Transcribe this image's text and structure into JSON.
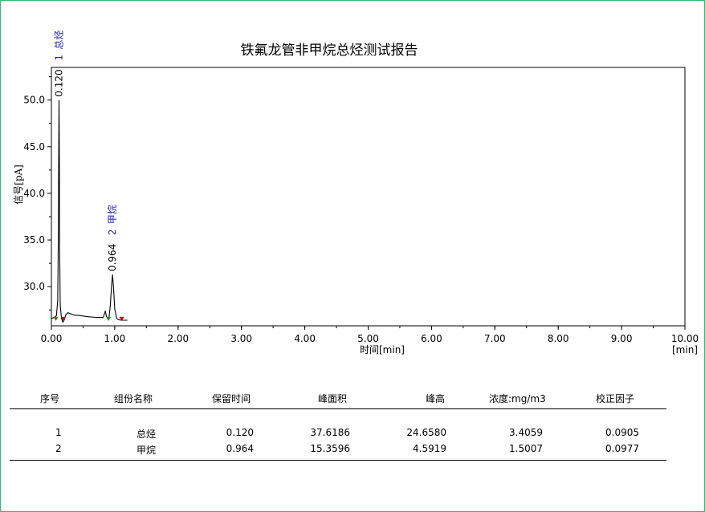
{
  "colors": {
    "border": "#3cb371",
    "trace": "#000000",
    "label_blue": "#1f1fbf",
    "marker_green": "#1a8f1a",
    "marker_red": "#cc0000"
  },
  "chart_data": {
    "type": "line",
    "title": "铁氟龙管非甲烷总烃测试报告",
    "xlabel": "时间[min]",
    "xunit": "[min]",
    "ylabel": "信号[pA]",
    "xlim": [
      0,
      10
    ],
    "ylim": [
      25.8,
      53.5
    ],
    "xticks": [
      "0.00",
      "1.00",
      "2.00",
      "3.00",
      "4.00",
      "5.00",
      "6.00",
      "7.00",
      "8.00",
      "9.00",
      "10.00"
    ],
    "yticks": [
      "30.0",
      "35.0",
      "40.0",
      "45.0",
      "50.0"
    ],
    "grid": false,
    "series": [
      {
        "x": [
          0.0,
          0.05,
          0.08,
          0.1,
          0.11,
          0.115,
          0.12,
          0.125,
          0.13,
          0.14,
          0.16,
          0.18,
          0.2,
          0.23,
          0.26,
          0.3,
          0.36,
          0.45,
          0.55,
          0.7,
          0.82,
          0.85,
          0.87,
          0.89,
          0.91,
          0.93,
          0.95,
          0.964,
          0.98,
          1.0,
          1.03,
          1.06,
          1.1,
          1.2
        ],
        "y": [
          26.6,
          26.7,
          26.9,
          28.5,
          36.0,
          44.0,
          50.0,
          44.0,
          34.0,
          28.0,
          26.6,
          26.2,
          26.4,
          27.0,
          27.2,
          27.1,
          26.95,
          26.9,
          26.8,
          26.7,
          26.7,
          27.4,
          26.8,
          26.6,
          26.7,
          28.0,
          30.2,
          31.3,
          30.0,
          27.6,
          26.6,
          26.45,
          26.4,
          26.4
        ]
      }
    ],
    "peaks": [
      {
        "rt": "0.120",
        "no": "1",
        "name": "总烃",
        "y": 50.0
      },
      {
        "rt": "0.964",
        "no": "2",
        "name": "甲烷",
        "y": 31.3
      }
    ],
    "baseline_markers": [
      {
        "x": 0.07,
        "color": "green"
      },
      {
        "x": 0.19,
        "color": "red"
      },
      {
        "x": 0.9,
        "color": "green"
      },
      {
        "x": 1.11,
        "color": "red"
      }
    ]
  },
  "table": {
    "headers": [
      "序号",
      "组份名称",
      "保留时间",
      "峰面积",
      "峰高",
      "浓度:mg/m3",
      "校正因子"
    ],
    "rows": [
      [
        "1",
        "总烃",
        "0.120",
        "37.6186",
        "24.6580",
        "3.4059",
        "0.0905"
      ],
      [
        "2",
        "甲烷",
        "0.964",
        "15.3596",
        "4.5919",
        "1.5007",
        "0.0977"
      ]
    ]
  }
}
